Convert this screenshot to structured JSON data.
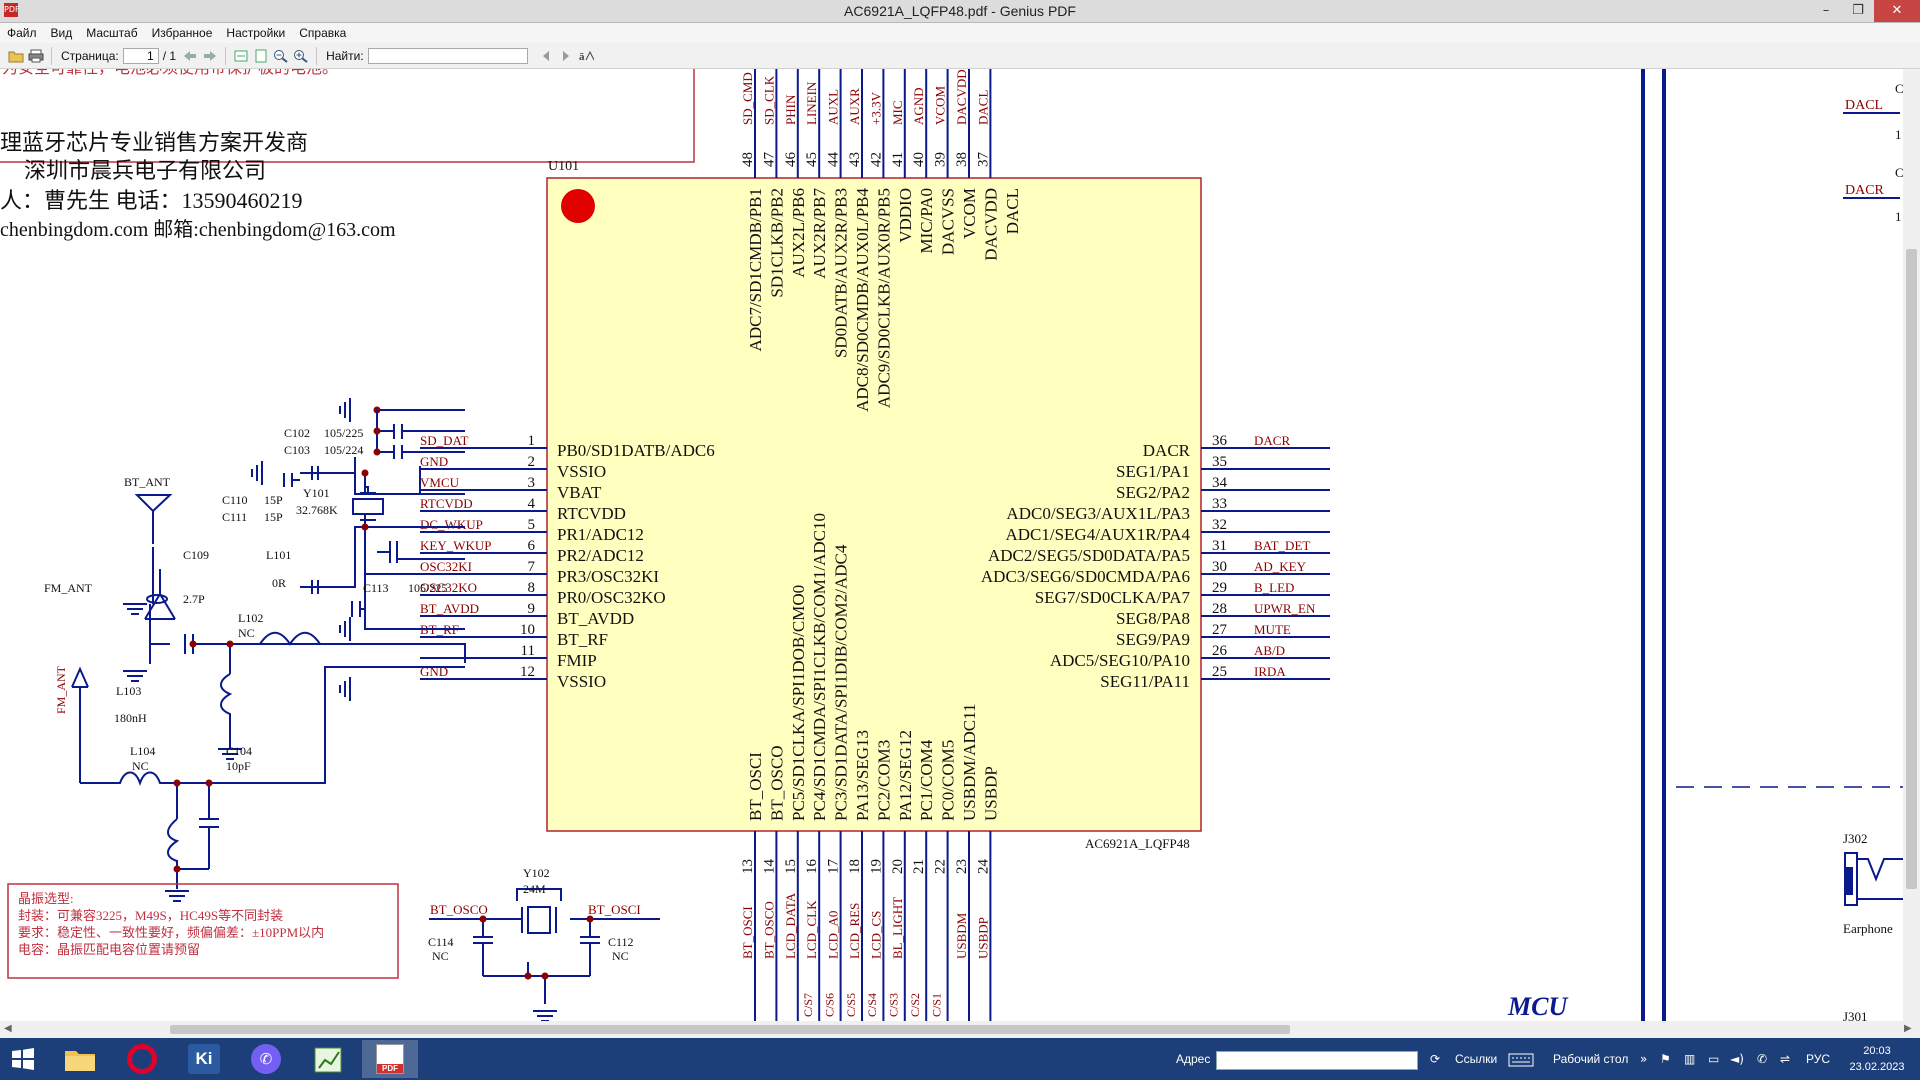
{
  "window": {
    "title": "AC6921A_LQFP48.pdf - Genius PDF",
    "app_icon": "PDF",
    "controls": {
      "minimize": "–",
      "maximize": "❐",
      "close": "✕"
    }
  },
  "menu": [
    "Файл",
    "Вид",
    "Масштаб",
    "Избранное",
    "Настройки",
    "Справка"
  ],
  "toolbar": {
    "page_label": "Страница:",
    "page_current": "1",
    "page_total": "/ 1",
    "find_label": "Найти:",
    "find_value": ""
  },
  "document": {
    "top_banner_note": "为安全可靠性，电池必须使用带保护板的电池。",
    "company": {
      "line1": "理蓝牙芯片专业销售方案开发商",
      "line2": "深圳市晨兵电子有限公司",
      "contact": "人：曹先生      电话：13590460219",
      "web_email": "chenbingdom.com    邮箱:chenbingdom@163.com"
    },
    "chip": {
      "ref": "U101",
      "part": "AC6921A_LQFP48",
      "left_pins": [
        {
          "num": "1",
          "name": "PB0/SD1DATB/ADC6",
          "net": "SD_DAT"
        },
        {
          "num": "2",
          "name": "VSSIO",
          "net": "GND"
        },
        {
          "num": "3",
          "name": "VBAT",
          "net": "VMCU"
        },
        {
          "num": "4",
          "name": "RTCVDD",
          "net": "RTCVDD"
        },
        {
          "num": "5",
          "name": "PR1/ADC12",
          "net": "DC_WKUP"
        },
        {
          "num": "6",
          "name": "PR2/ADC12",
          "net": "KEY_WKUP"
        },
        {
          "num": "7",
          "name": "PR3/OSC32KI",
          "net": "OSC32KI"
        },
        {
          "num": "8",
          "name": "PR0/OSC32KO",
          "net": "OSC32KO"
        },
        {
          "num": "9",
          "name": "BT_AVDD",
          "net": "BT_AVDD"
        },
        {
          "num": "10",
          "name": "BT_RF",
          "net": "BT_RF"
        },
        {
          "num": "11",
          "name": "FMIP",
          "net": ""
        },
        {
          "num": "12",
          "name": "VSSIO",
          "net": "GND"
        }
      ],
      "right_pins": [
        {
          "num": "36",
          "name": "DACR",
          "net": "DACR"
        },
        {
          "num": "35",
          "name": "SEG1/PA1",
          "net": ""
        },
        {
          "num": "34",
          "name": "SEG2/PA2",
          "net": ""
        },
        {
          "num": "33",
          "name": "ADC0/SEG3/AUX1L/PA3",
          "net": ""
        },
        {
          "num": "32",
          "name": "ADC1/SEG4/AUX1R/PA4",
          "net": ""
        },
        {
          "num": "31",
          "name": "ADC2/SEG5/SD0DATA/PA5",
          "net": "BAT_DET"
        },
        {
          "num": "30",
          "name": "ADC3/SEG6/SD0CMDA/PA6",
          "net": "AD_KEY"
        },
        {
          "num": "29",
          "name": "SEG7/SD0CLKA/PA7",
          "net": "B_LED"
        },
        {
          "num": "28",
          "name": "SEG8/PA8",
          "net": "UPWR_EN"
        },
        {
          "num": "27",
          "name": "SEG9/PA9",
          "net": "MUTE"
        },
        {
          "num": "26",
          "name": "ADC5/SEG10/PA10",
          "net": "AB/D"
        },
        {
          "num": "25",
          "name": "SEG11/PA11",
          "net": "IRDA"
        }
      ],
      "top_pins": [
        {
          "num": "48",
          "name": "ADC7/SD1CMDB/PB1",
          "net": "SD_CMD"
        },
        {
          "num": "47",
          "name": "SD1CLKB/PB2",
          "net": "SD_CLK"
        },
        {
          "num": "46",
          "name": "AUX2L/PB6",
          "net": "PHIN"
        },
        {
          "num": "45",
          "name": "AUX2R/PB7",
          "net": "LINEIN"
        },
        {
          "num": "44",
          "name": "SD0DATB/AUX2R/PB3",
          "net": "AUXL"
        },
        {
          "num": "43",
          "name": "ADC8/SD0CMDB/AUX0L/PB4",
          "net": "AUXR"
        },
        {
          "num": "42",
          "name": "ADC9/SD0CLKB/AUX0R/PB5",
          "net": "+3.3V"
        },
        {
          "num": "41",
          "name": "VDDIO",
          "net": "MIC"
        },
        {
          "num": "40",
          "name": "MIC/PA0",
          "net": "AGND"
        },
        {
          "num": "39",
          "name": "DACVSS",
          "net": "VCOM"
        },
        {
          "num": "38",
          "name": "VCOM",
          "net": "DACVDD"
        },
        {
          "num": "37",
          "name": "DACVDD",
          "net": "DACL"
        },
        {
          "num": "",
          "name": "DACL",
          "net": ""
        }
      ],
      "bottom_pins": [
        {
          "num": "13",
          "name": "BT_OSCI",
          "net": "BT_OSCI"
        },
        {
          "num": "14",
          "name": "BT_OSCO",
          "net": "BT_OSCO"
        },
        {
          "num": "15",
          "name": "PC5/SD1CLKA/SPI1DOB/CMO0",
          "net": "LCD_DATA"
        },
        {
          "num": "16",
          "name": "PC4/SD1CMDA/SPI1CLKB/COM1/ADC10",
          "net": "LCD_CLK"
        },
        {
          "num": "17",
          "name": "PC3/SD1DATA/SPI1DIB/COM2/ADC4",
          "net": "LCD_A0"
        },
        {
          "num": "18",
          "name": "PA13/SEG13",
          "net": "LCD_RES"
        },
        {
          "num": "19",
          "name": "PC2/COM3",
          "net": "LCD_CS"
        },
        {
          "num": "20",
          "name": "PA12/SEG12",
          "net": "BL_LIGHT"
        },
        {
          "num": "21",
          "name": "PC1/COM4",
          "net": ""
        },
        {
          "num": "22",
          "name": "PC0/COM5",
          "net": ""
        },
        {
          "num": "23",
          "name": "USBDM/ADC11",
          "net": "USBDM"
        },
        {
          "num": "24",
          "name": "USBDP",
          "net": "USBDP"
        }
      ],
      "bottom_bus_labels": [
        "C/S7",
        "C/S6",
        "C/S5",
        "C/S4",
        "C/S3",
        "C/S2",
        "C/S1"
      ]
    },
    "components": {
      "c102": "C102",
      "c102_val": "105/225",
      "c103": "C103",
      "c103_val": "105/224",
      "y101": "Y101",
      "y101_val": "32.768K",
      "c110": "C110",
      "c110_val": "15P",
      "c111": "C111",
      "c111_val": "15P",
      "c109": "C109",
      "c109_val": "2.7P",
      "l101": "L101",
      "l101_val": "0R",
      "l102": "L102",
      "l102_val": "NC",
      "c113": "C113",
      "c113_val": "105/225",
      "l103": "L103",
      "l103_val": "180nH",
      "l104": "L104",
      "l104_val": "NC",
      "c104": "C104",
      "c104_val": "10pF",
      "bt_ant": "BT_ANT",
      "fm_ant": "FM_ANT",
      "fm_ant_net": "FM_ANT",
      "y102": "Y102",
      "y102_val": "24M",
      "c114": "C114",
      "c114_val": "NC",
      "c112": "C112",
      "c112_val": "NC",
      "bt_osco": "BT_OSCO",
      "bt_osci": "BT_OSCI"
    },
    "crystal_note": {
      "title": "晶振选型:",
      "line1": "封装：可兼容3225，M49S，HC49S等不同封装",
      "line2": "要求：稳定性、一致性要好，频偏偏差：±10PPM以内",
      "line3": "电容：晶振匹配电容位置请预留"
    },
    "right_side": {
      "dacl": "DACL",
      "dacr": "DACR",
      "j302": "J302",
      "earphone": "Earphone",
      "j301": "J301",
      "section_title": "MCU",
      "c_mark_1": "C",
      "c_mark_2": "C",
      "one_1": "1",
      "one_2": "1"
    }
  },
  "taskbar": {
    "apps": [
      "explorer",
      "opera",
      "ki",
      "viber",
      "chart",
      "pdf"
    ],
    "opera_glyph": "O",
    "ki_glyph": "Ki",
    "pdf_glyph": "PDF",
    "address_label": "Адрес",
    "links_label": "Ссылки",
    "desktop_label": "Рабочий стол",
    "lang": "РУС",
    "time": "20:03",
    "date": "23.02.2023"
  },
  "colors": {
    "chip_fill": "#ffffc0",
    "chip_stroke": "#b02030",
    "wire": "#0a1a8c",
    "net_label": "#8b0000",
    "text": "#111111",
    "taskbar": "#1d3f79"
  }
}
